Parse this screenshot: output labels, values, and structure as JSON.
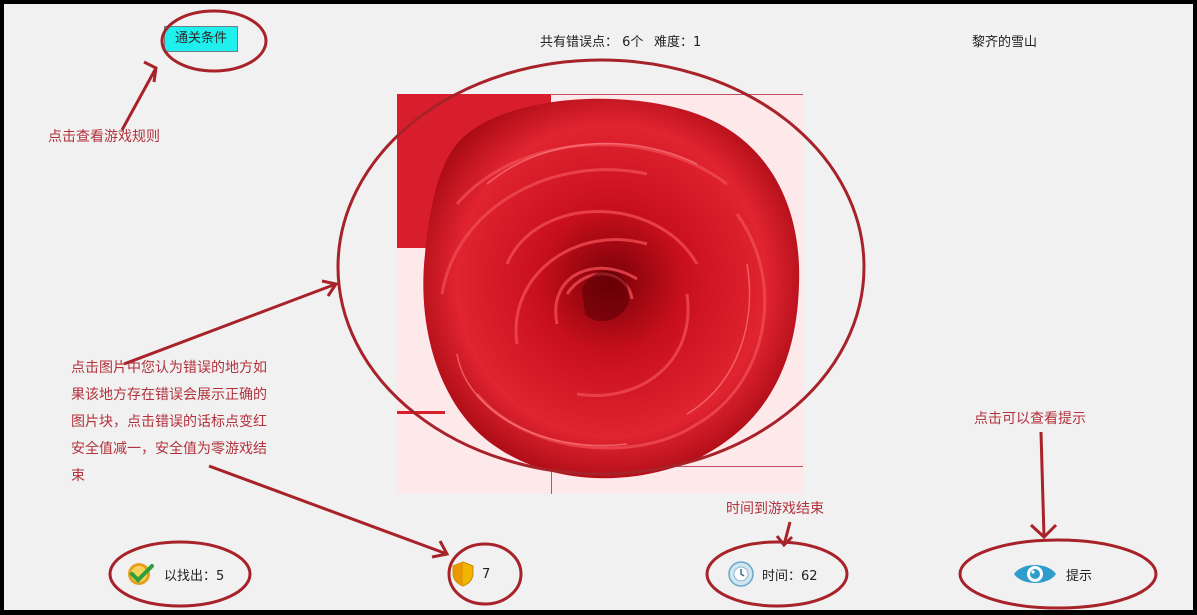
{
  "header": {
    "rules_button_label": "通关条件",
    "error_count_text": "共有错误点： 6个",
    "difficulty_text": "难度：1",
    "image_title": "黎齐的雪山"
  },
  "annotations": {
    "rules_note": "点击查看游戏规则",
    "click_note_lines": [
      "点击图片中您认为错误的地方如",
      "果该地方存在错误会展示正确的",
      "图片块，点击错误的话标点变红",
      "安全值减一，安全值为零游戏结",
      "束"
    ],
    "time_note": "时间到游戏结束",
    "hint_note": "点击可以查看提示"
  },
  "footer": {
    "found_text": "以找出：5",
    "safety_value": "7",
    "time_text": "时间：62",
    "hint_label": "提示"
  },
  "colors": {
    "annotation_red": "#b2323c",
    "rose_red": "#c8101c",
    "button_cyan": "#1ff0ee",
    "eye_blue": "#2f9ccc",
    "shield_gold": "#f2b500"
  }
}
